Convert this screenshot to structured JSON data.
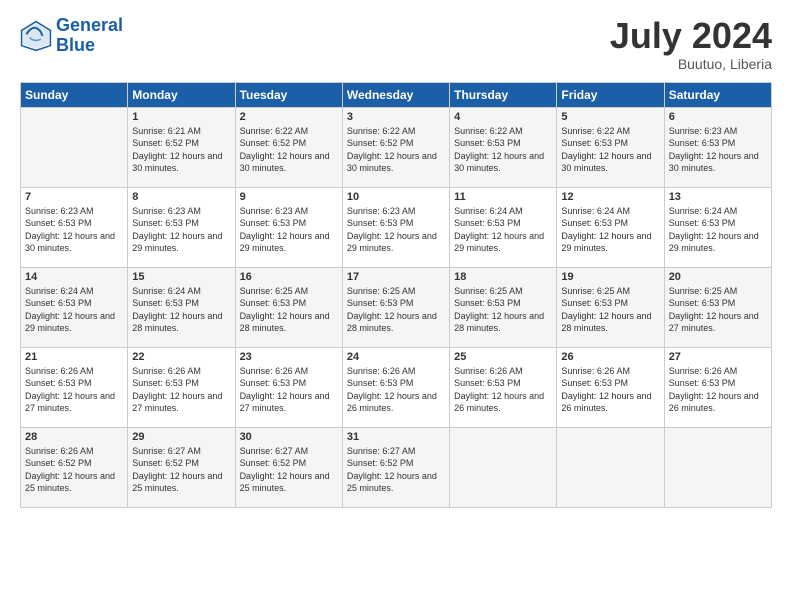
{
  "header": {
    "logo_general": "General",
    "logo_blue": "Blue",
    "month_year": "July 2024",
    "location": "Buutuo, Liberia"
  },
  "days_of_week": [
    "Sunday",
    "Monday",
    "Tuesday",
    "Wednesday",
    "Thursday",
    "Friday",
    "Saturday"
  ],
  "weeks": [
    [
      {
        "day": "",
        "sunrise": "",
        "sunset": "",
        "daylight": ""
      },
      {
        "day": "1",
        "sunrise": "6:21 AM",
        "sunset": "6:52 PM",
        "daylight": "12 hours and 30 minutes."
      },
      {
        "day": "2",
        "sunrise": "6:22 AM",
        "sunset": "6:52 PM",
        "daylight": "12 hours and 30 minutes."
      },
      {
        "day": "3",
        "sunrise": "6:22 AM",
        "sunset": "6:52 PM",
        "daylight": "12 hours and 30 minutes."
      },
      {
        "day": "4",
        "sunrise": "6:22 AM",
        "sunset": "6:53 PM",
        "daylight": "12 hours and 30 minutes."
      },
      {
        "day": "5",
        "sunrise": "6:22 AM",
        "sunset": "6:53 PM",
        "daylight": "12 hours and 30 minutes."
      },
      {
        "day": "6",
        "sunrise": "6:23 AM",
        "sunset": "6:53 PM",
        "daylight": "12 hours and 30 minutes."
      }
    ],
    [
      {
        "day": "7",
        "sunrise": "6:23 AM",
        "sunset": "6:53 PM",
        "daylight": "12 hours and 30 minutes."
      },
      {
        "day": "8",
        "sunrise": "6:23 AM",
        "sunset": "6:53 PM",
        "daylight": "12 hours and 29 minutes."
      },
      {
        "day": "9",
        "sunrise": "6:23 AM",
        "sunset": "6:53 PM",
        "daylight": "12 hours and 29 minutes."
      },
      {
        "day": "10",
        "sunrise": "6:23 AM",
        "sunset": "6:53 PM",
        "daylight": "12 hours and 29 minutes."
      },
      {
        "day": "11",
        "sunrise": "6:24 AM",
        "sunset": "6:53 PM",
        "daylight": "12 hours and 29 minutes."
      },
      {
        "day": "12",
        "sunrise": "6:24 AM",
        "sunset": "6:53 PM",
        "daylight": "12 hours and 29 minutes."
      },
      {
        "day": "13",
        "sunrise": "6:24 AM",
        "sunset": "6:53 PM",
        "daylight": "12 hours and 29 minutes."
      }
    ],
    [
      {
        "day": "14",
        "sunrise": "6:24 AM",
        "sunset": "6:53 PM",
        "daylight": "12 hours and 29 minutes."
      },
      {
        "day": "15",
        "sunrise": "6:24 AM",
        "sunset": "6:53 PM",
        "daylight": "12 hours and 28 minutes."
      },
      {
        "day": "16",
        "sunrise": "6:25 AM",
        "sunset": "6:53 PM",
        "daylight": "12 hours and 28 minutes."
      },
      {
        "day": "17",
        "sunrise": "6:25 AM",
        "sunset": "6:53 PM",
        "daylight": "12 hours and 28 minutes."
      },
      {
        "day": "18",
        "sunrise": "6:25 AM",
        "sunset": "6:53 PM",
        "daylight": "12 hours and 28 minutes."
      },
      {
        "day": "19",
        "sunrise": "6:25 AM",
        "sunset": "6:53 PM",
        "daylight": "12 hours and 28 minutes."
      },
      {
        "day": "20",
        "sunrise": "6:25 AM",
        "sunset": "6:53 PM",
        "daylight": "12 hours and 27 minutes."
      }
    ],
    [
      {
        "day": "21",
        "sunrise": "6:26 AM",
        "sunset": "6:53 PM",
        "daylight": "12 hours and 27 minutes."
      },
      {
        "day": "22",
        "sunrise": "6:26 AM",
        "sunset": "6:53 PM",
        "daylight": "12 hours and 27 minutes."
      },
      {
        "day": "23",
        "sunrise": "6:26 AM",
        "sunset": "6:53 PM",
        "daylight": "12 hours and 27 minutes."
      },
      {
        "day": "24",
        "sunrise": "6:26 AM",
        "sunset": "6:53 PM",
        "daylight": "12 hours and 26 minutes."
      },
      {
        "day": "25",
        "sunrise": "6:26 AM",
        "sunset": "6:53 PM",
        "daylight": "12 hours and 26 minutes."
      },
      {
        "day": "26",
        "sunrise": "6:26 AM",
        "sunset": "6:53 PM",
        "daylight": "12 hours and 26 minutes."
      },
      {
        "day": "27",
        "sunrise": "6:26 AM",
        "sunset": "6:53 PM",
        "daylight": "12 hours and 26 minutes."
      }
    ],
    [
      {
        "day": "28",
        "sunrise": "6:26 AM",
        "sunset": "6:52 PM",
        "daylight": "12 hours and 25 minutes."
      },
      {
        "day": "29",
        "sunrise": "6:27 AM",
        "sunset": "6:52 PM",
        "daylight": "12 hours and 25 minutes."
      },
      {
        "day": "30",
        "sunrise": "6:27 AM",
        "sunset": "6:52 PM",
        "daylight": "12 hours and 25 minutes."
      },
      {
        "day": "31",
        "sunrise": "6:27 AM",
        "sunset": "6:52 PM",
        "daylight": "12 hours and 25 minutes."
      },
      {
        "day": "",
        "sunrise": "",
        "sunset": "",
        "daylight": ""
      },
      {
        "day": "",
        "sunrise": "",
        "sunset": "",
        "daylight": ""
      },
      {
        "day": "",
        "sunrise": "",
        "sunset": "",
        "daylight": ""
      }
    ]
  ]
}
